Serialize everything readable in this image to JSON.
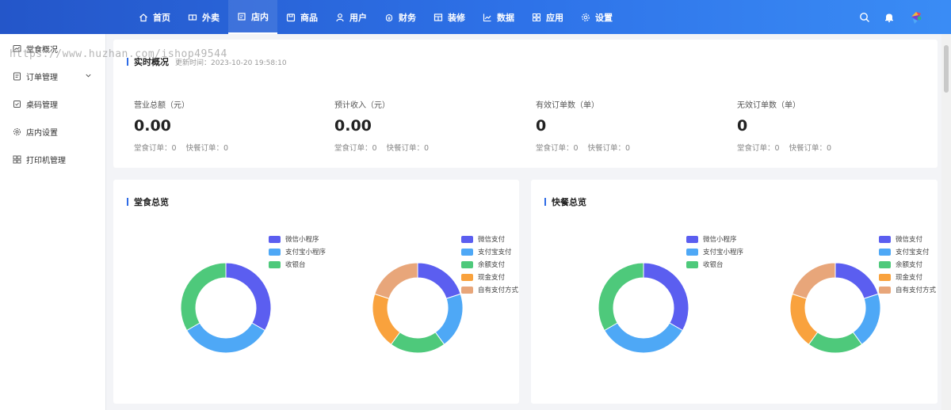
{
  "watermark": "https://www.huzhan.com/ishop49544",
  "nav": {
    "items": [
      {
        "label": "首页",
        "icon": "home-icon"
      },
      {
        "label": "外卖",
        "icon": "takeout-icon"
      },
      {
        "label": "店内",
        "icon": "store-icon",
        "active": true
      },
      {
        "label": "商品",
        "icon": "goods-icon"
      },
      {
        "label": "用户",
        "icon": "user-icon"
      },
      {
        "label": "财务",
        "icon": "finance-icon"
      },
      {
        "label": "装修",
        "icon": "decoration-icon"
      },
      {
        "label": "数据",
        "icon": "data-icon"
      },
      {
        "label": "应用",
        "icon": "apps-icon"
      },
      {
        "label": "设置",
        "icon": "settings-icon"
      }
    ]
  },
  "sidebar": {
    "items": [
      {
        "label": "堂食概况",
        "icon": "overview-icon"
      },
      {
        "label": "订单管理",
        "icon": "order-icon",
        "expandable": true
      },
      {
        "label": "桌码管理",
        "icon": "table-code-icon"
      },
      {
        "label": "店内设置",
        "icon": "gear-icon"
      },
      {
        "label": "打印机管理",
        "icon": "printer-icon"
      }
    ]
  },
  "realtime": {
    "title": "实时概况",
    "update_time": "更新时间：2023-10-20 19:58:10",
    "stats": [
      {
        "label": "营业总额（元）",
        "value": "0.00",
        "sub1": "堂食订单：0",
        "sub2": "快餐订单：0"
      },
      {
        "label": "预计收入（元）",
        "value": "0.00",
        "sub1": "堂食订单：0",
        "sub2": "快餐订单：0"
      },
      {
        "label": "有效订单数（单）",
        "value": "0",
        "sub1": "堂食订单：0",
        "sub2": "快餐订单：0"
      },
      {
        "label": "无效订单数（单）",
        "value": "0",
        "sub1": "堂食订单：0",
        "sub2": "快餐订单：0"
      }
    ]
  },
  "dine_in": {
    "title": "堂食总览"
  },
  "fast_food": {
    "title": "快餐总览"
  },
  "colors": {
    "accent": "#2e6be6",
    "purple": "#5b5ef0",
    "blue": "#4ea8f6",
    "green": "#4ec97b",
    "orange": "#f9a23d",
    "tan": "#e8a67a"
  },
  "chart_data": [
    {
      "type": "pie",
      "categories": [
        "微信小程序",
        "支付宝小程序",
        "收银台"
      ],
      "values": [
        1,
        1,
        1
      ],
      "colors": [
        "#5b5ef0",
        "#4ea8f6",
        "#4ec97b"
      ],
      "legend": "top-right"
    },
    {
      "type": "pie",
      "categories": [
        "微信支付",
        "支付宝支付",
        "余额支付",
        "现金支付",
        "自有支付方式"
      ],
      "values": [
        1,
        1,
        1,
        1,
        1
      ],
      "colors": [
        "#5b5ef0",
        "#4ea8f6",
        "#4ec97b",
        "#f9a23d",
        "#e8a67a"
      ],
      "legend": "top-right"
    },
    {
      "type": "pie",
      "categories": [
        "微信小程序",
        "支付宝小程序",
        "收银台"
      ],
      "values": [
        1,
        1,
        1
      ],
      "colors": [
        "#5b5ef0",
        "#4ea8f6",
        "#4ec97b"
      ],
      "legend": "top-right"
    },
    {
      "type": "pie",
      "categories": [
        "微信支付",
        "支付宝支付",
        "余额支付",
        "现金支付",
        "自有支付方式"
      ],
      "values": [
        1,
        1,
        1,
        1,
        1
      ],
      "colors": [
        "#5b5ef0",
        "#4ea8f6",
        "#4ec97b",
        "#f9a23d",
        "#e8a67a"
      ],
      "legend": "top-right"
    }
  ]
}
